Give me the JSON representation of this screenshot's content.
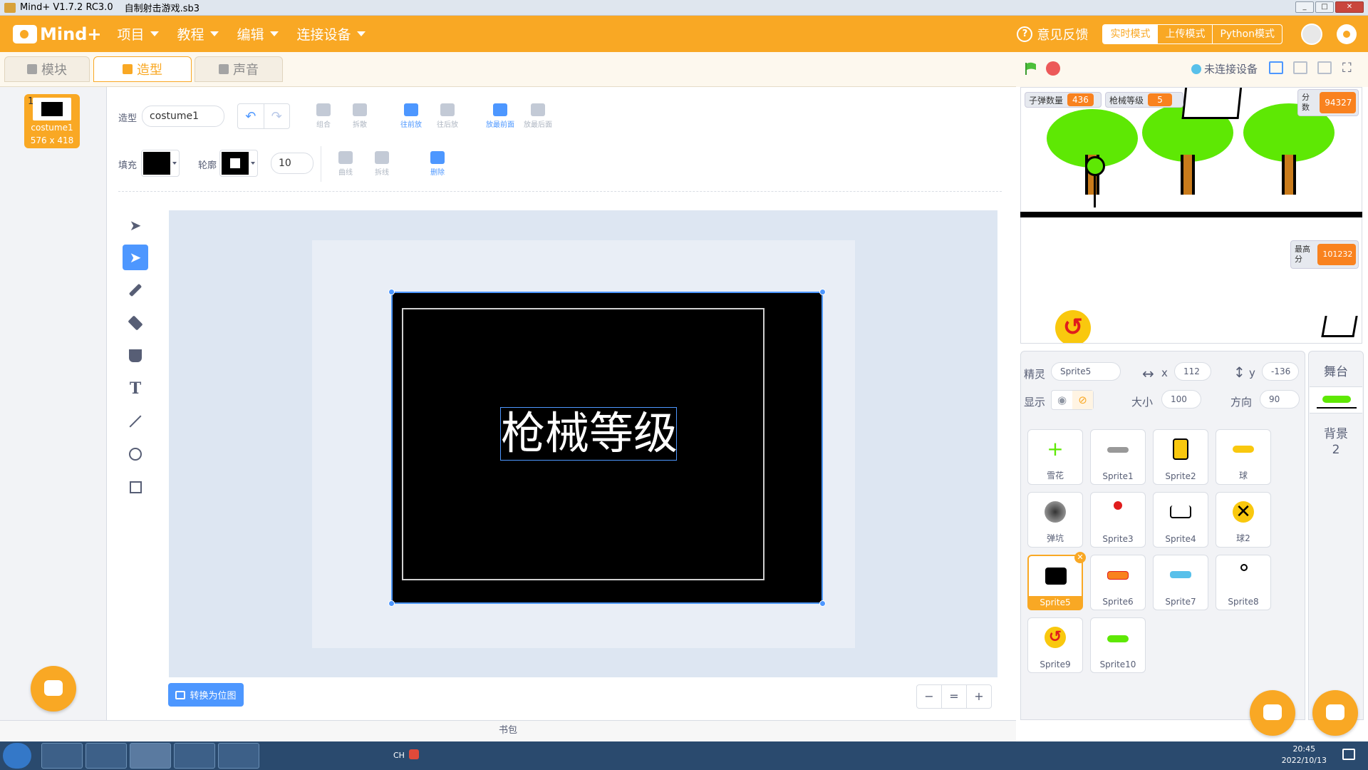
{
  "window": {
    "title": "Mind+ V1.7.2 RC3.0",
    "file": "自制射击游戏.sb3"
  },
  "menubar": {
    "logo": "Mind+",
    "items": [
      "项目",
      "教程",
      "编辑",
      "连接设备"
    ],
    "feedback": "意见反馈",
    "modes": [
      "实时模式",
      "上传模式",
      "Python模式"
    ],
    "active_mode": "实时模式"
  },
  "tabs": [
    {
      "label": "模块",
      "icon": "blocks-icon"
    },
    {
      "label": "造型",
      "icon": "brush-icon"
    },
    {
      "label": "声音",
      "icon": "speaker-icon"
    }
  ],
  "active_tab": "造型",
  "costume_list": [
    {
      "index": "1",
      "name": "costume1",
      "size": "576 x 418"
    }
  ],
  "paint": {
    "costume_label": "造型",
    "costume_name": "costume1",
    "fill_label": "填充",
    "outline_label": "轮廓",
    "outline_width": "10",
    "arrange": {
      "group": "组合",
      "ungroup": "拆散",
      "forward": "往前放",
      "backward": "往后放",
      "front": "放最前面",
      "back": "放最后面"
    },
    "shape": {
      "curve": "曲线",
      "corner": "拆线",
      "delete": "删除"
    },
    "canvas_text": "枪械等级",
    "convert_button": "转换为位图",
    "zoom": {
      "out": "−",
      "reset": "=",
      "in": "+"
    },
    "tools": [
      "select-tool",
      "reshape-tool",
      "brush-tool",
      "eraser-tool",
      "fill-tool",
      "text-tool",
      "line-tool",
      "circle-tool",
      "rectangle-tool"
    ],
    "active_tool": "reshape-tool"
  },
  "backpack": "书包",
  "stage": {
    "connection": "未连接设备",
    "vars": [
      {
        "label": "子弹数量",
        "value": "436"
      },
      {
        "label": "枪械等级",
        "value": "5"
      },
      {
        "label": "分数",
        "value": "94327"
      },
      {
        "label": "最高分",
        "value": "101232"
      }
    ],
    "tree_icon": "tree-icon",
    "reset_icon": "reset-icon",
    "cart_icon": "shopping-cart-icon"
  },
  "sprite_info": {
    "sprite_label": "精灵",
    "sprite_name": "Sprite5",
    "x_label": "x",
    "x": "112",
    "y_label": "y",
    "y": "-136",
    "show_label": "显示",
    "size_label": "大小",
    "size": "100",
    "direction_label": "方向",
    "direction": "90"
  },
  "sprites": [
    {
      "name": "雪花",
      "icon": "crosshair-icon"
    },
    {
      "name": "Sprite1",
      "icon": "gun-icon"
    },
    {
      "name": "Sprite2",
      "icon": "door-icon"
    },
    {
      "name": "球",
      "icon": "bullet-icon"
    },
    {
      "name": "弹坑",
      "icon": "crater-icon"
    },
    {
      "name": "Sprite3",
      "icon": "red-figure-icon"
    },
    {
      "name": "Sprite4",
      "icon": "cart-icon"
    },
    {
      "name": "球2",
      "icon": "x-ball-icon"
    },
    {
      "name": "Sprite5",
      "icon": "black-rect-icon"
    },
    {
      "name": "Sprite6",
      "icon": "label-icon"
    },
    {
      "name": "Sprite7",
      "icon": "label-icon"
    },
    {
      "name": "Sprite8",
      "icon": "stick-figure-icon"
    },
    {
      "name": "Sprite9",
      "icon": "reset-icon"
    },
    {
      "name": "Sprite10",
      "icon": "trees-icon"
    }
  ],
  "selected_sprite": "Sprite5",
  "stage_panel": {
    "title": "舞台",
    "backdrop_label": "背景",
    "backdrop_count": "2"
  },
  "taskbar": {
    "lang": "CH",
    "time": "20:45",
    "date": "2022/10/13"
  },
  "colors": {
    "brand": "#f9a824",
    "accent": "#4d97ff",
    "var_value": "#f9821f",
    "grass": "#5ee804"
  }
}
